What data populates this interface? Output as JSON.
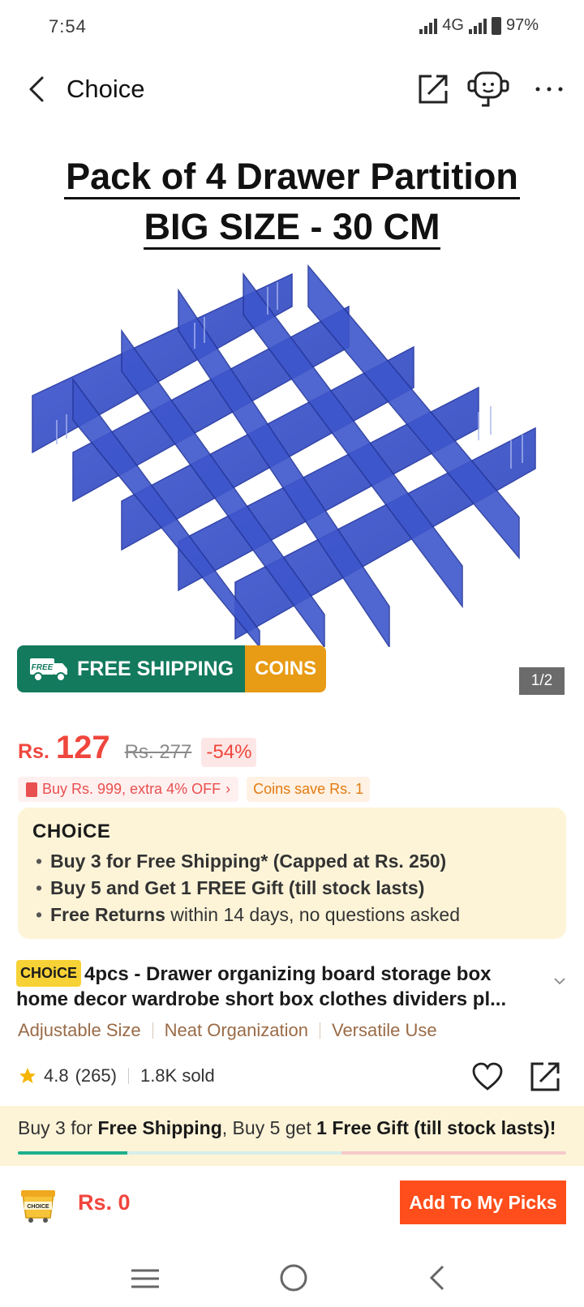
{
  "status_bar": {
    "time": "7:54",
    "network": "4G",
    "battery": "97%"
  },
  "header": {
    "title": "Choice",
    "icons": [
      "back-icon",
      "share-icon",
      "customer-service-icon",
      "more-icon"
    ]
  },
  "hero": {
    "line1": "Pack of 4 Drawer Partition",
    "line2": "BIG SIZE - 30 CM",
    "badge_ship_tag": "FREE",
    "badge_ship": "FREE SHIPPING",
    "badge_coins": "COINS",
    "pager": "1/2"
  },
  "price": {
    "currency": "Rs.",
    "value": "127",
    "original": "Rs. 277",
    "discount": "-54%",
    "promo": "Buy Rs. 999, extra 4% OFF",
    "coins": "Coins save Rs. 1"
  },
  "choice_card": {
    "logo": "CHOiCE",
    "items": [
      {
        "strong": "Buy 3 for  Free Shipping* (Capped at Rs. 250)",
        "rest": ""
      },
      {
        "strong": "Buy 5 and Get 1 FREE Gift (till stock lasts)",
        "rest": ""
      },
      {
        "strong": "Free Returns",
        "rest": " within 14 days, no questions asked"
      }
    ]
  },
  "product": {
    "tag": "CHOiCE",
    "title": "4pcs - Drawer organizing board storage box home decor wardrobe short box clothes dividers pl...",
    "features": [
      "Adjustable Size",
      "Neat Organization",
      "Versatile Use"
    ],
    "rating": "4.8",
    "reviews": "(265)",
    "sold": "1.8K sold"
  },
  "ship_banner": {
    "p1": "Buy 3 for ",
    "b1": "Free Shipping",
    "p2": ", Buy 5 get ",
    "b2": "1 Free Gift (till stock lasts)!",
    "progress": 0.2
  },
  "action_bar": {
    "cart_label": "CHOICE",
    "total": "Rs. 0",
    "button": "Add To My Picks"
  },
  "colors": {
    "accent": "#f0463d",
    "cta": "#ff4e1b",
    "ship_green": "#137a5e",
    "coins_orange": "#e89b14",
    "choice_yellow": "#f7d236"
  }
}
